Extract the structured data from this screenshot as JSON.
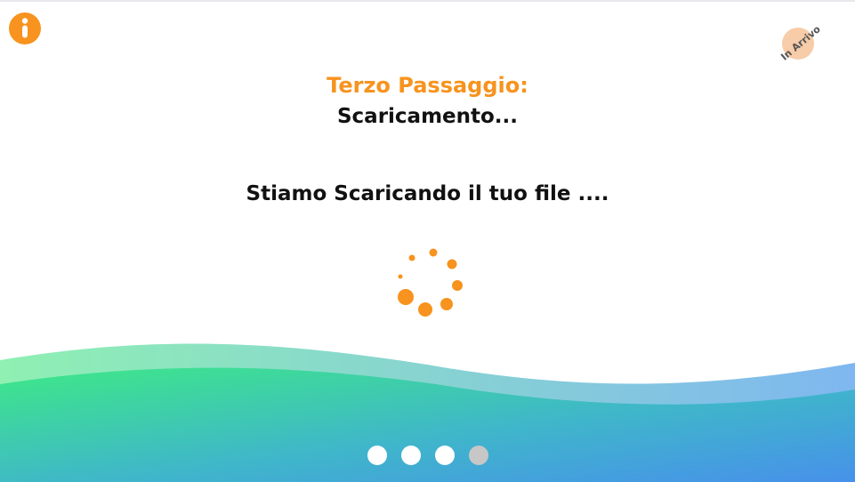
{
  "info_button": {
    "icon": "info-icon",
    "color": "#f7931e"
  },
  "badge": {
    "text": "In Arrivo"
  },
  "step": {
    "title": "Terzo Passaggio:",
    "subtitle": "Scaricamento..."
  },
  "message": "Stiamo Scaricando il tuo file ....",
  "spinner": {
    "icon": "loading-spinner-icon",
    "color": "#f7931e"
  },
  "pagination": {
    "total": 4,
    "current": 4
  },
  "colors": {
    "accent": "#f7931e",
    "wave_start": "#3ee887",
    "wave_end": "#4791ea"
  }
}
